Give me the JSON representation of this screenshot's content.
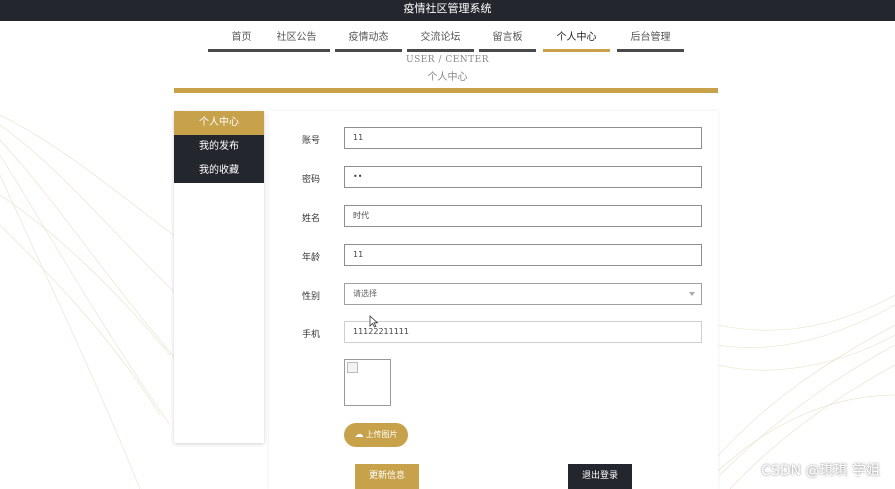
{
  "app": {
    "title": "疫情社区管理系统"
  },
  "nav": {
    "items": [
      {
        "label": "首页"
      },
      {
        "label": "社区公告"
      },
      {
        "label": "疫情动态"
      },
      {
        "label": "交流论坛"
      },
      {
        "label": "留言板"
      },
      {
        "label": "个人中心"
      },
      {
        "label": "后台管理"
      }
    ],
    "active": "个人中心"
  },
  "page": {
    "subtitle_en": "USER / CENTER",
    "subtitle_cn": "个人中心"
  },
  "sidebar": {
    "items": [
      {
        "label": "个人中心"
      },
      {
        "label": "我的发布"
      },
      {
        "label": "我的收藏"
      }
    ]
  },
  "form": {
    "account": {
      "label": "账号",
      "value": "11"
    },
    "password": {
      "label": "密码",
      "value": "••"
    },
    "name": {
      "label": "姓名",
      "value": "时代"
    },
    "age": {
      "label": "年龄",
      "value": "11"
    },
    "gender": {
      "label": "性别",
      "placeholder": "请选择"
    },
    "phone": {
      "label": "手机",
      "value": "11122211111"
    },
    "avatar_icon": "broken-image-icon",
    "upload_label": "上传图片",
    "upload_icon": "cloud-upload-icon"
  },
  "actions": {
    "update_label": "更新信息",
    "logout_label": "退出登录"
  },
  "watermark": "CSDN @琪琪 学姐",
  "colors": {
    "gold": "#c7a24b",
    "dark": "#23262d"
  }
}
